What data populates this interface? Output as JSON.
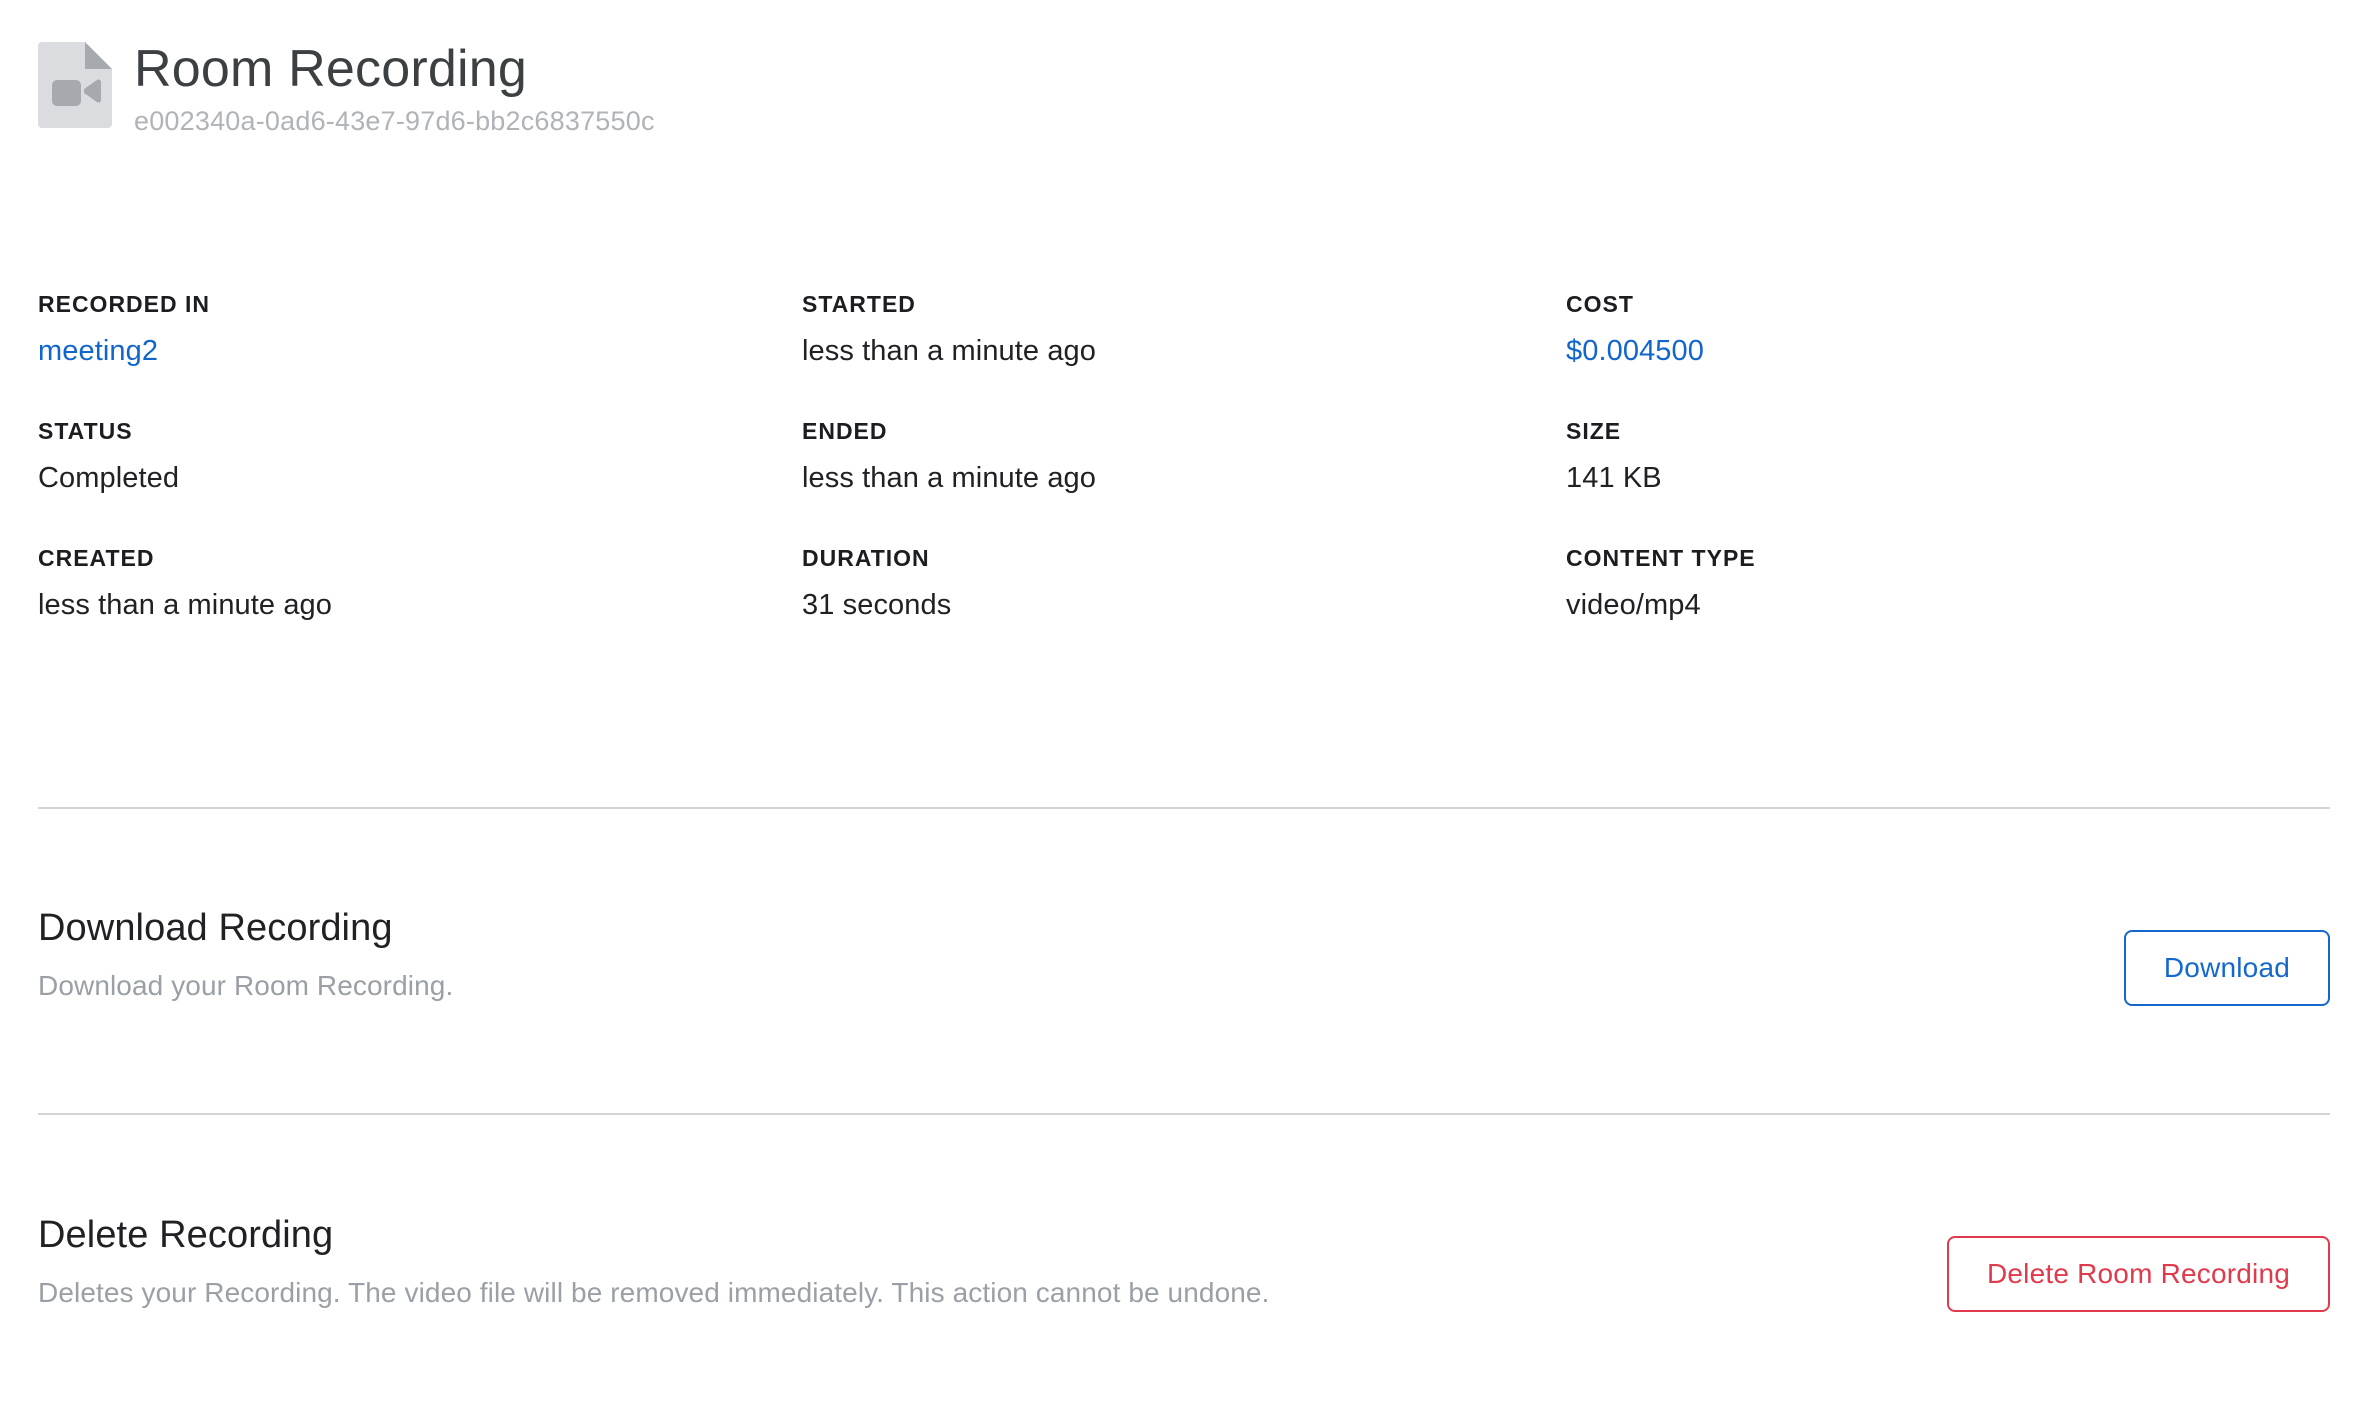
{
  "header": {
    "title": "Room Recording",
    "subtitle": "e002340a-0ad6-43e7-97d6-bb2c6837550c",
    "icon": "video-file-icon"
  },
  "details": [
    {
      "label": "RECORDED IN",
      "value": "meeting2",
      "is_link": true
    },
    {
      "label": "STARTED",
      "value": "less than a minute ago",
      "is_link": false
    },
    {
      "label": "COST",
      "value": "$0.004500",
      "is_link": true
    },
    {
      "label": "STATUS",
      "value": "Completed",
      "is_link": false
    },
    {
      "label": "ENDED",
      "value": "less than a minute ago",
      "is_link": false
    },
    {
      "label": "SIZE",
      "value": "141 KB",
      "is_link": false
    },
    {
      "label": "CREATED",
      "value": "less than a minute ago",
      "is_link": false
    },
    {
      "label": "DURATION",
      "value": "31 seconds",
      "is_link": false
    },
    {
      "label": "CONTENT TYPE",
      "value": "video/mp4",
      "is_link": false
    }
  ],
  "download_section": {
    "title": "Download Recording",
    "description": "Download your Room Recording.",
    "button_label": "Download"
  },
  "delete_section": {
    "title": "Delete Recording",
    "description": "Deletes your Recording. The video file will be removed immediately. This action cannot be undone.",
    "button_label": "Delete Room Recording"
  },
  "colors": {
    "link": "#1166cc",
    "primary_action": "#1468cc",
    "danger": "#e03b4d",
    "title": "#3c4043",
    "muted": "#9aa0a6",
    "subtitle": "#b0b3b8",
    "divider": "#d4d4d4",
    "icon_page": "#dadce0",
    "icon_glyph": "#a6a9ad"
  }
}
